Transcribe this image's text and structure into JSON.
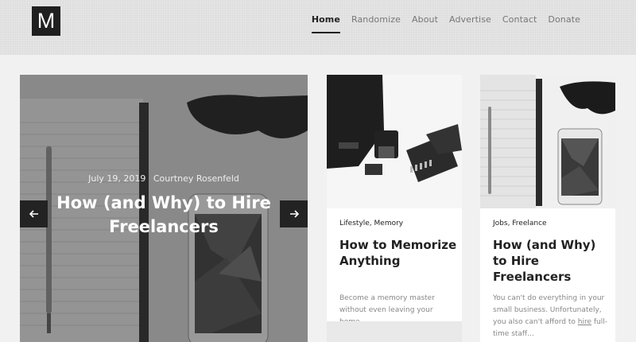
{
  "header": {
    "logo_letter": "M",
    "nav": [
      {
        "label": "Home",
        "active": true
      },
      {
        "label": "Randomize",
        "active": false
      },
      {
        "label": "About",
        "active": false
      },
      {
        "label": "Advertise",
        "active": false
      },
      {
        "label": "Contact",
        "active": false
      },
      {
        "label": "Donate",
        "active": false
      }
    ]
  },
  "hero": {
    "date": "July 19, 2019",
    "author": "Courtney Rosenfeld",
    "title": "How (and Why) to Hire Freelancers",
    "prev_icon": "arrow-left-icon",
    "next_icon": "arrow-right-icon"
  },
  "cards": [
    {
      "categories": "Lifestyle, Memory",
      "title": "How to Memorize Anything",
      "excerpt": "Become a memory master without even leaving your home.."
    },
    {
      "categories": "Jobs, Freelance",
      "title": "How (and Why) to Hire Freelancers",
      "excerpt_a": "You can't do everything in your small business. Unfortunately, you also can't afford to ",
      "excerpt_link": "hire",
      "excerpt_b": " full-time staff..."
    }
  ]
}
